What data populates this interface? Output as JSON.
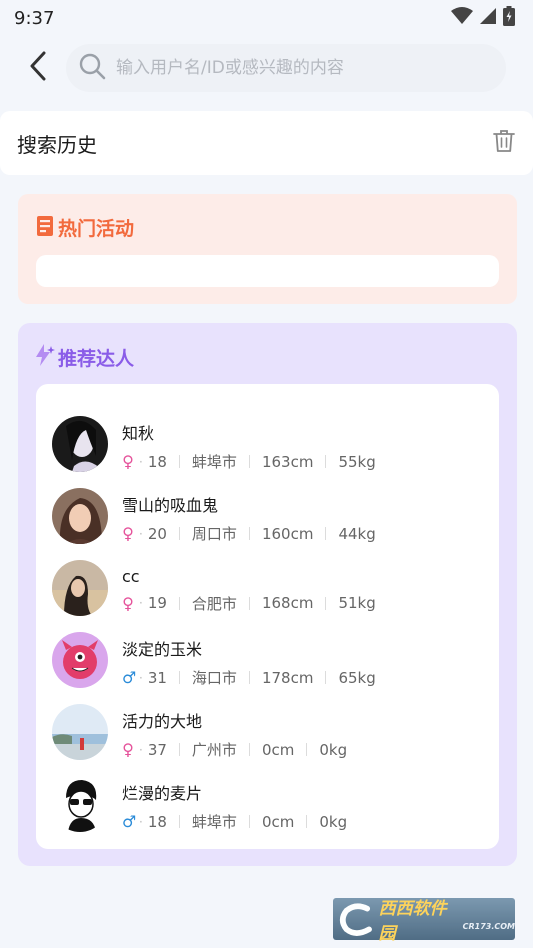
{
  "status_bar": {
    "time": "9:37"
  },
  "search": {
    "placeholder": "输入用户名/ID或感兴趣的内容",
    "value": ""
  },
  "history": {
    "title": "搜索历史"
  },
  "hot": {
    "title": "热门活动",
    "accent": "#f26a3d"
  },
  "recommend": {
    "title": "推荐达人",
    "accent": "#8a5ce8",
    "users": [
      {
        "name": "知秋",
        "sex": "♀",
        "age": "18",
        "city": "蚌埠市",
        "height": "163cm",
        "weight": "55kg"
      },
      {
        "name": "雪山的吸血鬼",
        "sex": "♀",
        "age": "20",
        "city": "周口市",
        "height": "160cm",
        "weight": "44kg"
      },
      {
        "name": "cc",
        "sex": "♀",
        "age": "19",
        "city": "合肥市",
        "height": "168cm",
        "weight": "51kg"
      },
      {
        "name": "淡定的玉米",
        "sex": "♂",
        "age": "31",
        "city": "海口市",
        "height": "178cm",
        "weight": "65kg"
      },
      {
        "name": "活力的大地",
        "sex": "♀",
        "age": "37",
        "city": "广州市",
        "height": "0cm",
        "weight": "0kg"
      },
      {
        "name": "烂漫的麦片",
        "sex": "♂",
        "age": "18",
        "city": "蚌埠市",
        "height": "0cm",
        "weight": "0kg"
      }
    ]
  },
  "watermark": {
    "brand": "西西软件园",
    "domain": "CR173.COM"
  }
}
